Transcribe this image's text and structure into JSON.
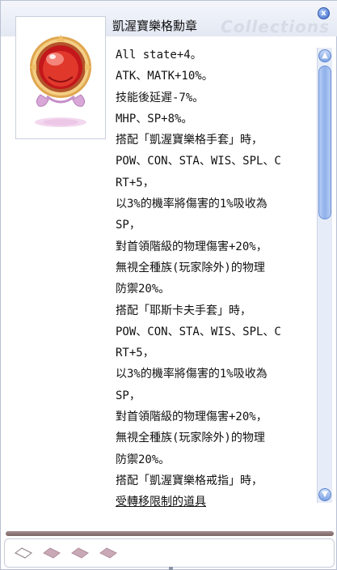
{
  "window": {
    "title": "凱渥寶樂格勳章",
    "watermark": "Collections",
    "close_glyph": "x"
  },
  "item": {
    "icon": "medal-ornament-icon"
  },
  "description": {
    "lines": [
      "All state+4。",
      "ATK、MATK+10%。",
      "技能後延遲-7%。",
      "MHP、SP+8%。",
      "搭配「凱渥寶樂格手套」時，",
      "POW、CON、STA、WIS、SPL、C",
      "RT+5，",
      "以3%的機率將傷害的1%吸收為",
      "SP，",
      "對首領階級的物理傷害+20%，",
      "無視全種族(玩家除外)的物理",
      "防禦20%。",
      "搭配「耶斯卡夫手套」時，",
      "POW、CON、STA、WIS、SPL、C",
      "RT+5，",
      "以3%的機率將傷害的1%吸收為",
      "SP，",
      "對首領階級的物理傷害+20%，",
      "無視全種族(玩家除外)的物理",
      "防禦20%。",
      "搭配「凱渥寶樂格戒指」時，"
    ],
    "footer": "受轉移限制的道具"
  },
  "scrollbar": {
    "up_glyph": "▲",
    "down_glyph": "▼"
  },
  "slots": {
    "count": 4,
    "first_empty": true
  },
  "colors": {
    "slot_filled": "#c9a9b6",
    "slot_empty_border": "#8a7c86",
    "divider": "#8a7272",
    "scroll_accent": "#7ea3e4"
  }
}
